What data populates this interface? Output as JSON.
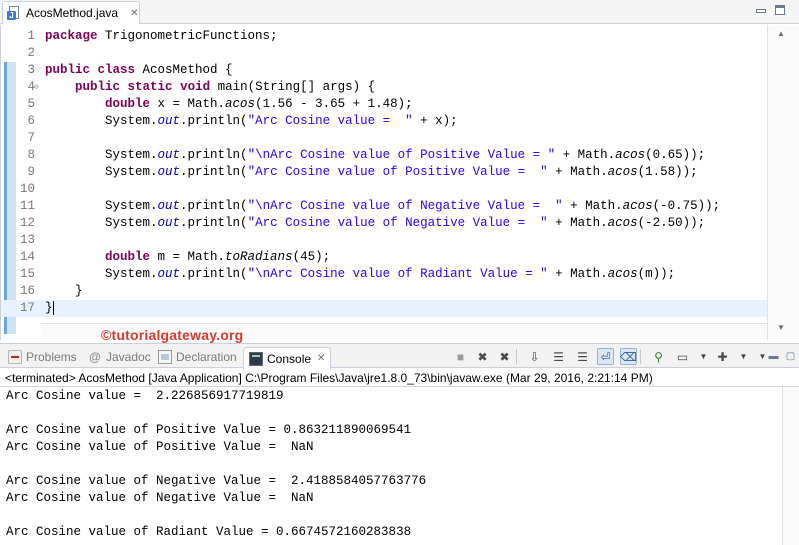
{
  "editor_tab": {
    "filename": "AcosMethod.java",
    "close": "✕"
  },
  "code_lines": [
    {
      "num": "1",
      "segments": [
        {
          "t": "package",
          "c": "kw"
        },
        {
          "t": " TrigonometricFunctions;",
          "c": ""
        }
      ]
    },
    {
      "num": "2",
      "segments": []
    },
    {
      "num": "3",
      "segments": [
        {
          "t": "public",
          "c": "kw"
        },
        {
          "t": " ",
          "c": ""
        },
        {
          "t": "class",
          "c": "kw"
        },
        {
          "t": " AcosMethod {",
          "c": ""
        }
      ]
    },
    {
      "num": "4",
      "fold": true,
      "segments": [
        {
          "t": "    ",
          "c": ""
        },
        {
          "t": "public",
          "c": "kw"
        },
        {
          "t": " ",
          "c": ""
        },
        {
          "t": "static",
          "c": "kw"
        },
        {
          "t": " ",
          "c": ""
        },
        {
          "t": "void",
          "c": "kw"
        },
        {
          "t": " main(String[] args) {",
          "c": ""
        }
      ]
    },
    {
      "num": "5",
      "segments": [
        {
          "t": "        ",
          "c": ""
        },
        {
          "t": "double",
          "c": "kw"
        },
        {
          "t": " x = Math.",
          "c": ""
        },
        {
          "t": "acos",
          "c": "it"
        },
        {
          "t": "(1.56 - 3.65 + 1.48);",
          "c": ""
        }
      ]
    },
    {
      "num": "6",
      "segments": [
        {
          "t": "        System.",
          "c": ""
        },
        {
          "t": "out",
          "c": "fld"
        },
        {
          "t": ".println(",
          "c": ""
        },
        {
          "t": "\"Arc Cosine value =  \"",
          "c": "str"
        },
        {
          "t": " + x);",
          "c": ""
        }
      ]
    },
    {
      "num": "7",
      "segments": []
    },
    {
      "num": "8",
      "segments": [
        {
          "t": "        System.",
          "c": ""
        },
        {
          "t": "out",
          "c": "fld"
        },
        {
          "t": ".println(",
          "c": ""
        },
        {
          "t": "\"\\nArc Cosine value of Positive Value = \"",
          "c": "str"
        },
        {
          "t": " + Math.",
          "c": ""
        },
        {
          "t": "acos",
          "c": "it"
        },
        {
          "t": "(0.65));",
          "c": ""
        }
      ]
    },
    {
      "num": "9",
      "segments": [
        {
          "t": "        System.",
          "c": ""
        },
        {
          "t": "out",
          "c": "fld"
        },
        {
          "t": ".println(",
          "c": ""
        },
        {
          "t": "\"Arc Cosine value of Positive Value =  \"",
          "c": "str"
        },
        {
          "t": " + Math.",
          "c": ""
        },
        {
          "t": "acos",
          "c": "it"
        },
        {
          "t": "(1.58));",
          "c": ""
        }
      ]
    },
    {
      "num": "10",
      "segments": []
    },
    {
      "num": "11",
      "segments": [
        {
          "t": "        System.",
          "c": ""
        },
        {
          "t": "out",
          "c": "fld"
        },
        {
          "t": ".println(",
          "c": ""
        },
        {
          "t": "\"\\nArc Cosine value of Negative Value =  \"",
          "c": "str"
        },
        {
          "t": " + Math.",
          "c": ""
        },
        {
          "t": "acos",
          "c": "it"
        },
        {
          "t": "(-0.75));",
          "c": ""
        }
      ]
    },
    {
      "num": "12",
      "segments": [
        {
          "t": "        System.",
          "c": ""
        },
        {
          "t": "out",
          "c": "fld"
        },
        {
          "t": ".println(",
          "c": ""
        },
        {
          "t": "\"Arc Cosine value of Negative Value =  \"",
          "c": "str"
        },
        {
          "t": " + Math.",
          "c": ""
        },
        {
          "t": "acos",
          "c": "it"
        },
        {
          "t": "(-2.50));",
          "c": ""
        }
      ]
    },
    {
      "num": "13",
      "segments": []
    },
    {
      "num": "14",
      "segments": [
        {
          "t": "        ",
          "c": ""
        },
        {
          "t": "double",
          "c": "kw"
        },
        {
          "t": " m = Math.",
          "c": ""
        },
        {
          "t": "toRadians",
          "c": "it"
        },
        {
          "t": "(45);",
          "c": ""
        }
      ]
    },
    {
      "num": "15",
      "segments": [
        {
          "t": "        System.",
          "c": ""
        },
        {
          "t": "out",
          "c": "fld"
        },
        {
          "t": ".println(",
          "c": ""
        },
        {
          "t": "\"\\nArc Cosine value of Radiant Value = \"",
          "c": "str"
        },
        {
          "t": " + Math.",
          "c": ""
        },
        {
          "t": "acos",
          "c": "it"
        },
        {
          "t": "(m));",
          "c": ""
        }
      ]
    },
    {
      "num": "16",
      "segments": [
        {
          "t": "    }",
          "c": ""
        }
      ]
    },
    {
      "num": "17",
      "current": true,
      "segments": [
        {
          "t": "}",
          "c": ""
        }
      ]
    }
  ],
  "watermark": "©tutorialgateway.org",
  "views": {
    "problems": "Problems",
    "javadoc": "Javadoc",
    "declaration": "Declaration",
    "console": "Console"
  },
  "console_toolbar": [
    {
      "name": "terminate-icon",
      "glyph": "■"
    },
    {
      "name": "remove-launch-icon",
      "glyph": "✖"
    },
    {
      "name": "remove-all-terminated-icon",
      "glyph": "✖"
    },
    {
      "name": "scroll-lock-icon",
      "glyph": "⇩"
    },
    {
      "name": "show-on-stdout-icon",
      "glyph": "☰"
    },
    {
      "name": "show-on-stderr-icon",
      "glyph": "☰"
    },
    {
      "name": "word-wrap-icon",
      "glyph": "⏎"
    },
    {
      "name": "clear-console-icon",
      "glyph": "⌫"
    },
    {
      "name": "pin-console-icon",
      "glyph": "⚲"
    },
    {
      "name": "display-console-icon",
      "glyph": "▭"
    },
    {
      "name": "open-console-icon",
      "glyph": "✚"
    }
  ],
  "status": "<terminated> AcosMethod [Java Application] C:\\Program Files\\Java\\jre1.8.0_73\\bin\\javaw.exe (Mar 29, 2016, 2:21:14 PM)",
  "console_lines": [
    "Arc Cosine value =  2.226856917719819",
    "",
    "Arc Cosine value of Positive Value = 0.863211890069541",
    "Arc Cosine value of Positive Value =  NaN",
    "",
    "Arc Cosine value of Negative Value =  2.4188584057763776",
    "Arc Cosine value of Negative Value =  NaN",
    "",
    "Arc Cosine value of Radiant Value = 0.6674572160283838"
  ]
}
